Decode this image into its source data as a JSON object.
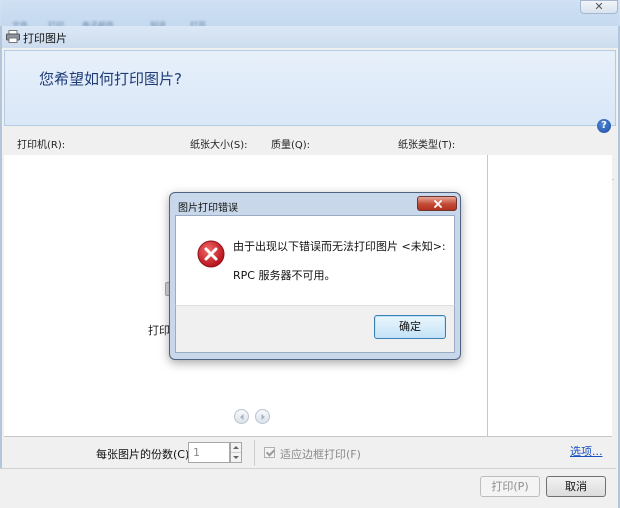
{
  "background_window": {
    "menu_fragments": [
      "文件",
      "打印",
      "电子邮件",
      "刻录",
      "打开"
    ],
    "close_glyph": "✕"
  },
  "window": {
    "title": "打印图片",
    "header_title": "您希望如何打印图片?"
  },
  "toolbar": {
    "printer_label": "打印机(R):",
    "paper_size_label": "纸张大小(S):",
    "quality_label": "质量(Q):",
    "paper_type_label": "纸张类型(T):",
    "printer_value": "",
    "paper_size_value": "",
    "quality_value": "",
    "paper_type_value": ""
  },
  "preview": {
    "truncated_label": "打印"
  },
  "bottom": {
    "copies_label": "每张图片的份数(C):",
    "copies_value": "1",
    "fit_label": "适应边框打印(F)",
    "fit_checked": true,
    "options_link": "选项..."
  },
  "footer": {
    "print_button": "打印(P)",
    "cancel_button": "取消"
  },
  "dialog": {
    "title": "图片打印错误",
    "message_line1": "由于出现以下错误而无法打印图片 <未知>:",
    "message_line2": "RPC 服务器不可用。",
    "ok_button": "确定"
  },
  "colors": {
    "header_title": "#1f3c78",
    "error_red": "#d8202a",
    "link_blue": "#1a4fbf"
  }
}
